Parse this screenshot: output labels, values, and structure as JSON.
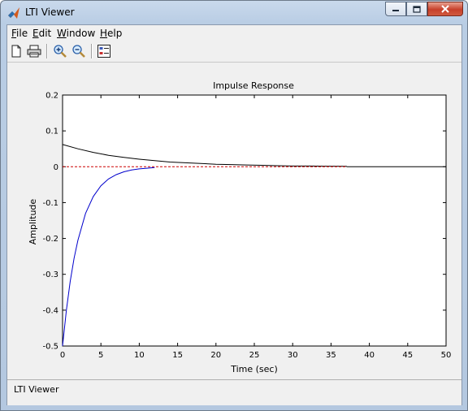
{
  "window": {
    "title": "LTI Viewer",
    "app_icon": "matlab-icon",
    "caption_buttons": [
      "minimize-icon",
      "maximize-icon",
      "close-icon"
    ]
  },
  "menu": [
    {
      "label_underline": "F",
      "label_rest": "ile"
    },
    {
      "label_underline": "E",
      "label_rest": "dit"
    },
    {
      "label_underline": "W",
      "label_rest": "indow"
    },
    {
      "label_underline": "H",
      "label_rest": "elp"
    }
  ],
  "toolbar": {
    "icons": [
      "new-document-icon",
      "print-icon",
      "zoom-in-icon",
      "zoom-out-icon",
      "plot-configuration-icon"
    ]
  },
  "status": {
    "text": "LTI Viewer"
  },
  "chart_data": {
    "type": "line",
    "title": "Impulse Response",
    "xlabel": "Time (sec)",
    "ylabel": "Amplitude",
    "xlim": [
      0,
      50
    ],
    "ylim": [
      -0.5,
      0.2
    ],
    "xticks": [
      "0",
      "5",
      "10",
      "15",
      "20",
      "25",
      "30",
      "35",
      "40",
      "45",
      "50"
    ],
    "yticks": [
      "0.2",
      "0.1",
      "0",
      "-0.1",
      "-0.2",
      "-0.3",
      "-0.4",
      "-0.5"
    ],
    "grid": false,
    "series": [
      {
        "color": "#000000",
        "x": [
          0,
          2,
          4,
          6,
          8,
          10,
          12,
          14,
          16,
          18,
          20,
          22,
          24,
          26,
          28,
          30,
          32,
          34,
          37,
          37.1,
          50
        ],
        "y": [
          0.062,
          0.05,
          0.04,
          0.032,
          0.026,
          0.021,
          0.017,
          0.013,
          0.011,
          0.009,
          0.007,
          0.006,
          0.005,
          0.004,
          0.003,
          0.002,
          0.002,
          0.0015,
          0.0012,
          0,
          0
        ]
      },
      {
        "color": "#0000cc",
        "x": [
          0,
          0.5,
          1,
          1.5,
          2,
          3,
          4,
          5,
          6,
          7,
          8,
          9,
          10,
          11,
          12
        ],
        "y": [
          -0.5,
          -0.4,
          -0.32,
          -0.255,
          -0.205,
          -0.13,
          -0.083,
          -0.053,
          -0.034,
          -0.022,
          -0.014,
          -0.009,
          -0.006,
          -0.004,
          -0.002
        ]
      },
      {
        "color": "#cc0000",
        "style": "dashed",
        "x": [
          0,
          37
        ],
        "y": [
          0,
          0
        ]
      }
    ]
  }
}
